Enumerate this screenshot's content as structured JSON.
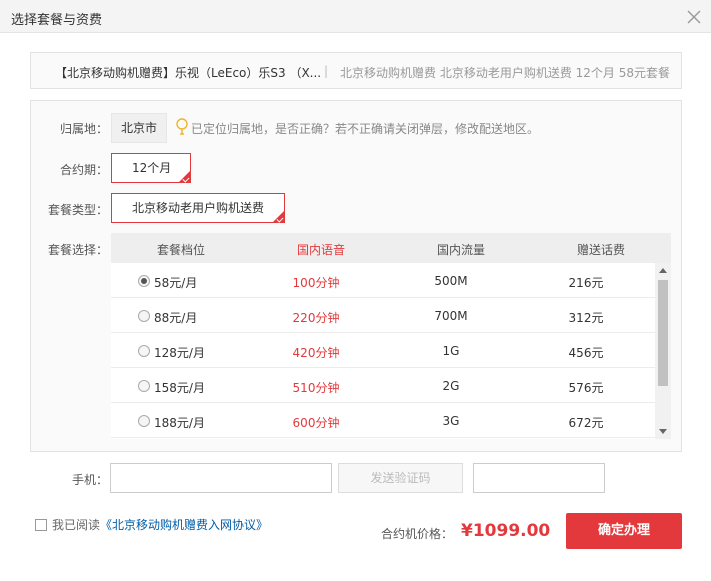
{
  "dialog": {
    "title": "选择套餐与资费"
  },
  "product": {
    "name": "【北京移动购机赠费】乐视（LeEco）乐S3 （X...",
    "separator": "|",
    "summary": "北京移动购机赠费  北京移动老用户购机送费 12个月 58元套餐"
  },
  "region": {
    "label": "归属地：",
    "value": "北京市",
    "tip": "已定位归属地，是否正确？若不正确请关闭弹层，修改配送地区。"
  },
  "contract": {
    "label": "合约期：",
    "value": "12个月"
  },
  "plan_type": {
    "label": "套餐类型：",
    "value": "北京移动老用户购机送费"
  },
  "plan_select": {
    "label": "套餐选择：",
    "headers": [
      "套餐档位",
      "国内语音",
      "国内流量",
      "赠送话费"
    ],
    "rows": [
      {
        "tier": "58元/月",
        "voice": "100分钟",
        "data": "500M",
        "bonus": "216元",
        "selected": true
      },
      {
        "tier": "88元/月",
        "voice": "220分钟",
        "data": "700M",
        "bonus": "312元",
        "selected": false
      },
      {
        "tier": "128元/月",
        "voice": "420分钟",
        "data": "1G",
        "bonus": "456元",
        "selected": false
      },
      {
        "tier": "158元/月",
        "voice": "510分钟",
        "data": "2G",
        "bonus": "576元",
        "selected": false
      },
      {
        "tier": "188元/月",
        "voice": "600分钟",
        "data": "3G",
        "bonus": "672元",
        "selected": false
      }
    ]
  },
  "phone": {
    "label": "手机：",
    "value": "",
    "sms_button": "发送验证码",
    "code_value": ""
  },
  "agreement": {
    "prefix": "我已阅读",
    "link": "《北京移动购机赠费入网协议》",
    "checked": false
  },
  "price": {
    "label": "合约机价格：",
    "value": "¥1099.00"
  },
  "confirm_label": "确定办理",
  "colors": {
    "accent": "#e4393c",
    "link": "#005ea7"
  }
}
